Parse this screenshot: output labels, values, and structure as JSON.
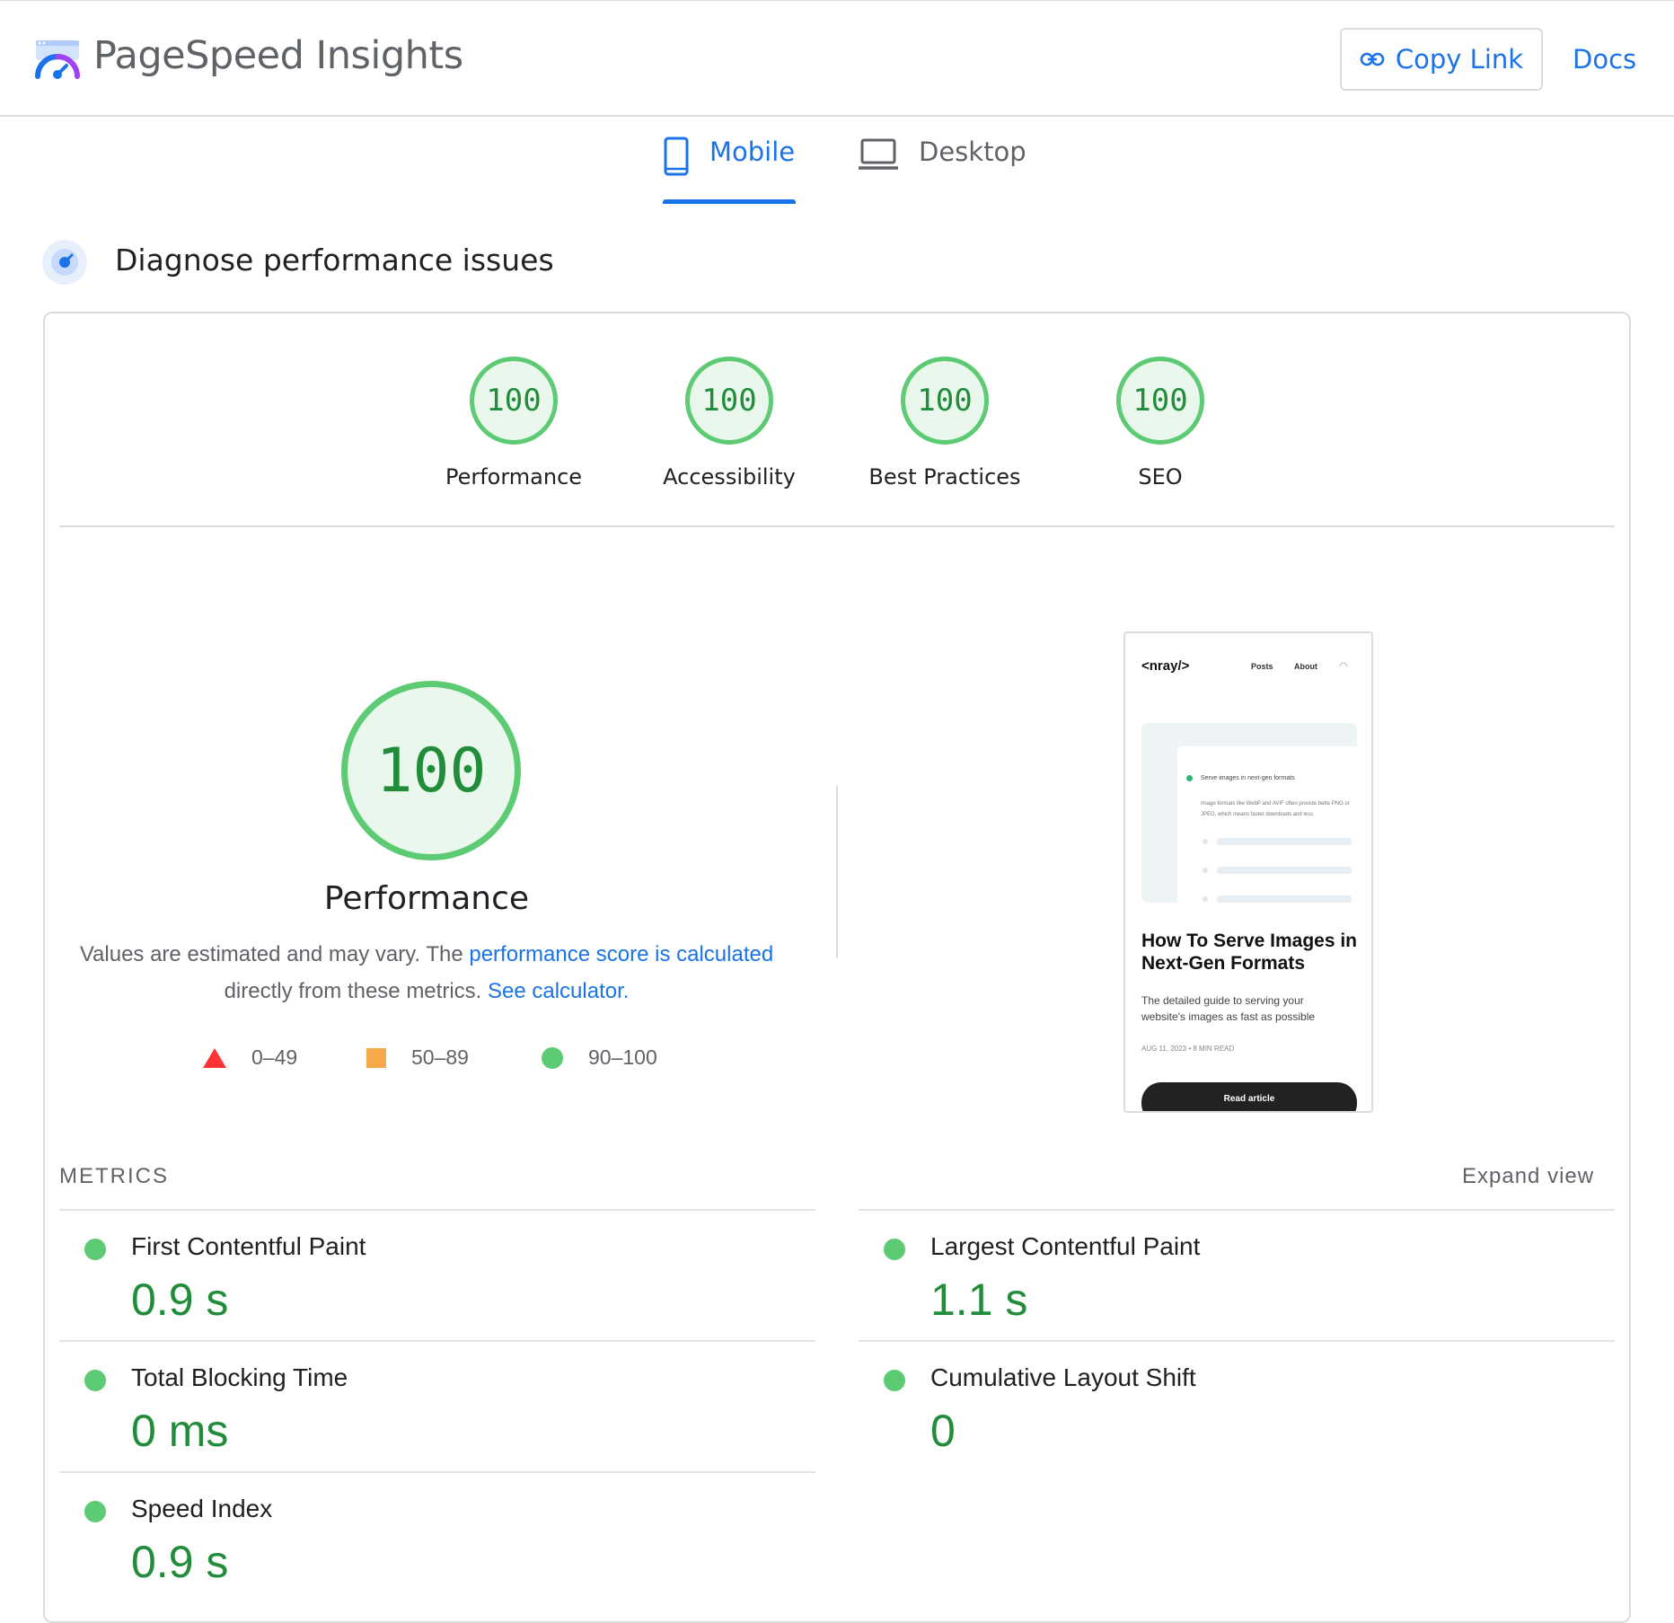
{
  "header": {
    "app_title": "PageSpeed Insights",
    "copy_link_label": "Copy Link",
    "docs_label": "Docs"
  },
  "tabs": [
    {
      "label": "Mobile",
      "active": true
    },
    {
      "label": "Desktop",
      "active": false
    }
  ],
  "section": {
    "title": "Diagnose performance issues"
  },
  "scores": [
    {
      "label": "Performance",
      "value": "100"
    },
    {
      "label": "Accessibility",
      "value": "100"
    },
    {
      "label": "Best Practices",
      "value": "100"
    },
    {
      "label": "SEO",
      "value": "100"
    }
  ],
  "performance": {
    "score": "100",
    "label": "Performance",
    "note_prefix": "Values are estimated and may vary. The ",
    "note_link1": "performance score is calculated",
    "note_middle": " directly from these metrics. ",
    "note_link2": "See calculator."
  },
  "legend": [
    {
      "shape": "triangle",
      "color": "#ff3333",
      "range": "0–49"
    },
    {
      "shape": "square",
      "color": "#f6a94a",
      "range": "50–89"
    },
    {
      "shape": "circle",
      "color": "#5ccb73",
      "range": "90–100"
    }
  ],
  "screenshot": {
    "brand": "<nray/>",
    "nav": [
      "Posts",
      "About"
    ],
    "panel_heading": "Serve images in next-gen formats",
    "panel_text": "Image formats like WebP and AVIF often provide bette PNG or JPEG, which means faster downloads and less",
    "article_title": "How To Serve Images in Next-Gen Formats",
    "article_desc": "The detailed guide to serving your website's images as fast as possible",
    "article_meta": "AUG 11, 2023 • 8 MIN READ",
    "cta": "Read article"
  },
  "metrics": {
    "title": "METRICS",
    "expand_label": "Expand view",
    "items": [
      {
        "name": "First Contentful Paint",
        "value": "0.9 s",
        "status": "good"
      },
      {
        "name": "Largest Contentful Paint",
        "value": "1.1 s",
        "status": "good"
      },
      {
        "name": "Total Blocking Time",
        "value": "0 ms",
        "status": "good"
      },
      {
        "name": "Cumulative Layout Shift",
        "value": "0",
        "status": "good"
      },
      {
        "name": "Speed Index",
        "value": "0.9 s",
        "status": "good"
      }
    ]
  },
  "colors": {
    "accent": "#1a73e8",
    "pass": "#5ccb73",
    "pass_text": "#218c3a"
  }
}
